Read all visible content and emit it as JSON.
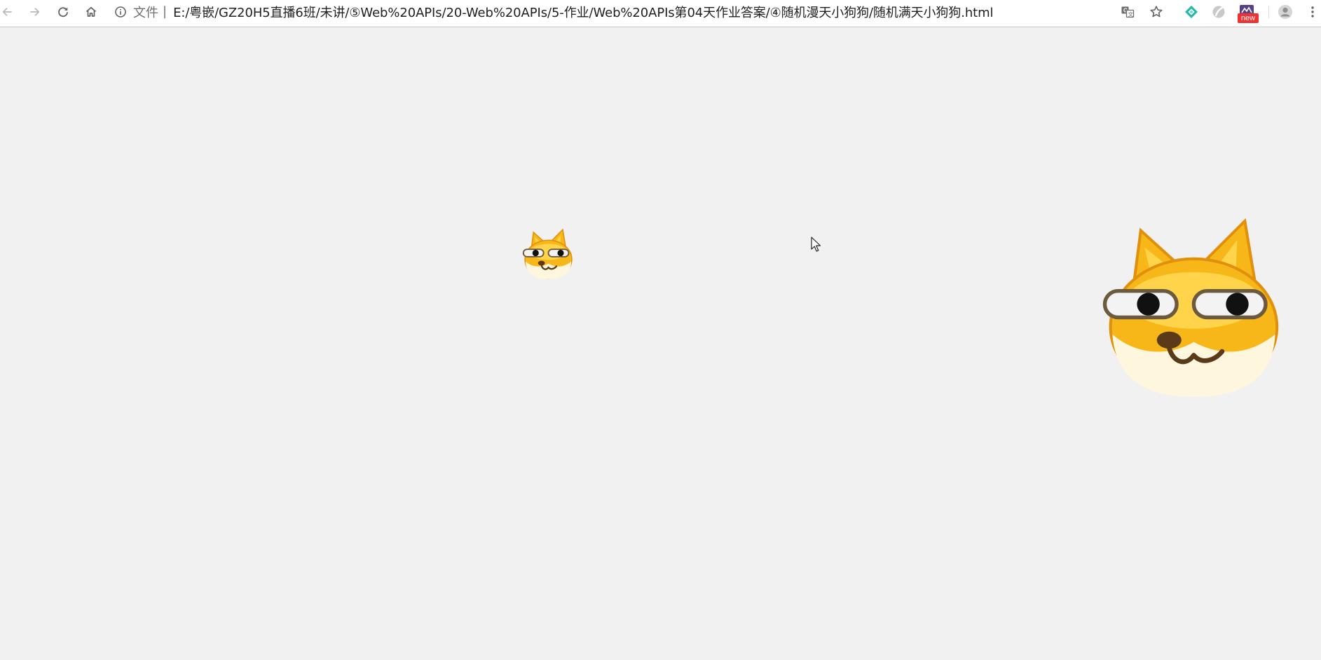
{
  "browser": {
    "toolbar": {
      "back_icon": "arrow-left-icon",
      "forward_icon": "arrow-right-icon",
      "reload_icon": "reload-icon",
      "home_icon": "home-icon"
    },
    "omnibox": {
      "info_icon": "info-icon",
      "scheme_label": "文件",
      "url": "E:/粤嵌/GZ20H5直播6班/未讲/⑤Web%20APIs/20-Web%20APIs/5-作业/Web%20APIs第04天作业答案/④随机漫天小狗狗/随机满天小狗狗.html"
    },
    "actions": {
      "translate_icon": "translate-icon",
      "bookmark_icon": "star-icon",
      "extension_1_icon": "diamond-extension-icon",
      "extension_2_icon": "gray-extension-icon",
      "extension_3_icon": "new-extension-icon",
      "extension_3_badge": "new",
      "profile_icon": "avatar-icon",
      "menu_icon": "kebab-menu-icon"
    }
  },
  "page": {
    "background": "#f1f1f1",
    "images": [
      {
        "name": "small-dog",
        "icon": "doge-emoji-icon"
      },
      {
        "name": "large-dog",
        "icon": "doge-emoji-icon"
      }
    ],
    "cursor": "mouse-pointer-icon"
  },
  "colors": {
    "dog_fur": "#f7b718",
    "dog_fur_light": "#ffd44a",
    "dog_face": "#fff7dd",
    "dog_outline": "#e0900c",
    "new_badge": "#e33333",
    "extension_teal": "#2bb7a6",
    "extension_purple": "#5a3f8c"
  }
}
